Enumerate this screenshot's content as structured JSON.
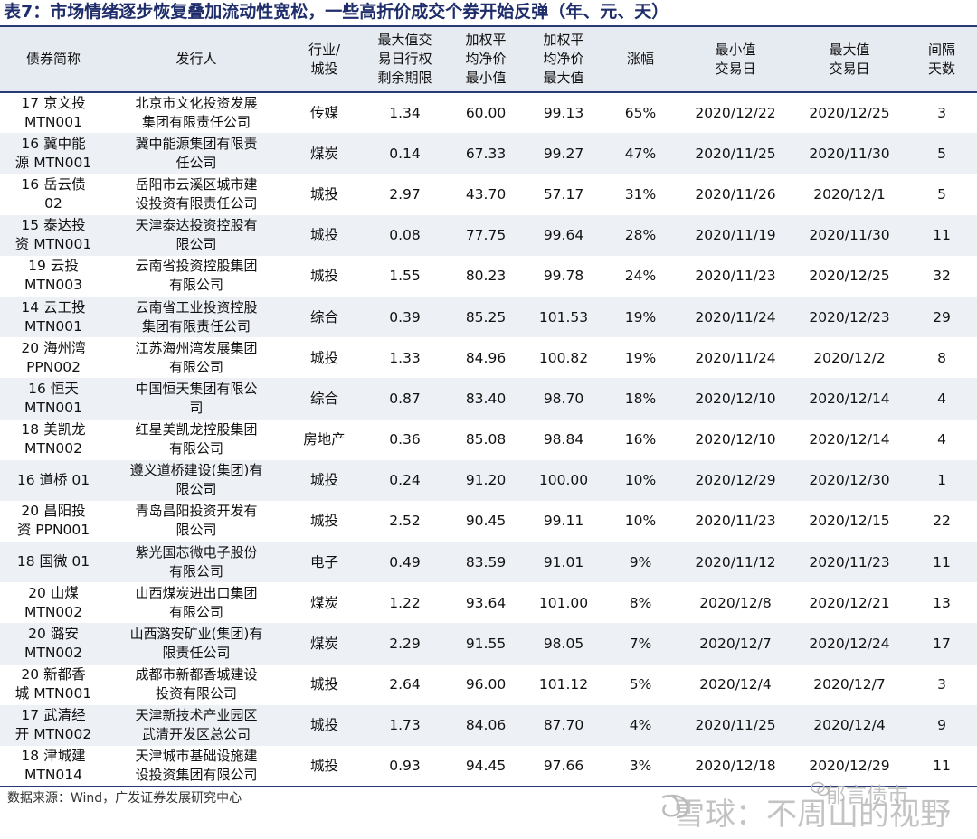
{
  "title": "表7：市场情绪逐步恢复叠加流动性宽松，一些高折价成交个券开始反弹（年、元、天）",
  "headers": {
    "name": "债券简称",
    "issuer": "发行人",
    "industry": "行业/\n城投",
    "remaining": "最大值交\n易日行权\n剩余期限",
    "min_price": "加权平\n均净价\n最小值",
    "max_price": "加权平\n均净价\n最大值",
    "rise": "涨幅",
    "min_date": "最小值\n交易日",
    "max_date": "最大值\n交易日",
    "interval": "间隔\n天数"
  },
  "rows": [
    {
      "name": "17 京文投\nMTN001",
      "issuer": "北京市文化投资发展\n集团有限责任公司",
      "industry": "传媒",
      "remaining": "1.34",
      "min_price": "60.00",
      "max_price": "99.13",
      "rise": "65%",
      "min_date": "2020/12/22",
      "max_date": "2020/12/25",
      "interval": "3"
    },
    {
      "name": "16 冀中能\n源 MTN001",
      "issuer": "冀中能源集团有限责\n任公司",
      "industry": "煤炭",
      "remaining": "0.14",
      "min_price": "67.33",
      "max_price": "99.27",
      "rise": "47%",
      "min_date": "2020/11/25",
      "max_date": "2020/11/30",
      "interval": "5"
    },
    {
      "name": "16 岳云债\n02",
      "issuer": "岳阳市云溪区城市建\n设投资有限责任公司",
      "industry": "城投",
      "remaining": "2.97",
      "min_price": "43.70",
      "max_price": "57.17",
      "rise": "31%",
      "min_date": "2020/11/26",
      "max_date": "2020/12/1",
      "interval": "5"
    },
    {
      "name": "15 泰达投\n资 MTN001",
      "issuer": "天津泰达投资控股有\n限公司",
      "industry": "城投",
      "remaining": "0.08",
      "min_price": "77.75",
      "max_price": "99.64",
      "rise": "28%",
      "min_date": "2020/11/19",
      "max_date": "2020/11/30",
      "interval": "11"
    },
    {
      "name": "19 云投\nMTN003",
      "issuer": "云南省投资控股集团\n有限公司",
      "industry": "城投",
      "remaining": "1.55",
      "min_price": "80.23",
      "max_price": "99.78",
      "rise": "24%",
      "min_date": "2020/11/23",
      "max_date": "2020/12/25",
      "interval": "32"
    },
    {
      "name": "14 云工投\nMTN001",
      "issuer": "云南省工业投资控股\n集团有限责任公司",
      "industry": "综合",
      "remaining": "0.39",
      "min_price": "85.25",
      "max_price": "101.53",
      "rise": "19%",
      "min_date": "2020/11/24",
      "max_date": "2020/12/23",
      "interval": "29"
    },
    {
      "name": "20 海州湾\nPPN002",
      "issuer": "江苏海州湾发展集团\n有限公司",
      "industry": "城投",
      "remaining": "1.33",
      "min_price": "84.96",
      "max_price": "100.82",
      "rise": "19%",
      "min_date": "2020/11/24",
      "max_date": "2020/12/2",
      "interval": "8"
    },
    {
      "name": "16 恒天\nMTN001",
      "issuer": "中国恒天集团有限公\n司",
      "industry": "综合",
      "remaining": "0.87",
      "min_price": "83.40",
      "max_price": "98.70",
      "rise": "18%",
      "min_date": "2020/12/10",
      "max_date": "2020/12/14",
      "interval": "4"
    },
    {
      "name": "18 美凯龙\nMTN002",
      "issuer": "红星美凯龙控股集团\n有限公司",
      "industry": "房地产",
      "remaining": "0.36",
      "min_price": "85.08",
      "max_price": "98.84",
      "rise": "16%",
      "min_date": "2020/12/10",
      "max_date": "2020/12/14",
      "interval": "4"
    },
    {
      "name": "16 道桥 01",
      "issuer": "遵义道桥建设(集团)有\n限公司",
      "industry": "城投",
      "remaining": "0.24",
      "min_price": "91.20",
      "max_price": "100.00",
      "rise": "10%",
      "min_date": "2020/12/29",
      "max_date": "2020/12/30",
      "interval": "1"
    },
    {
      "name": "20 昌阳投\n资 PPN001",
      "issuer": "青岛昌阳投资开发有\n限公司",
      "industry": "城投",
      "remaining": "2.52",
      "min_price": "90.45",
      "max_price": "99.11",
      "rise": "10%",
      "min_date": "2020/11/23",
      "max_date": "2020/12/15",
      "interval": "22"
    },
    {
      "name": "18 国微 01",
      "issuer": "紫光国芯微电子股份\n有限公司",
      "industry": "电子",
      "remaining": "0.49",
      "min_price": "83.59",
      "max_price": "91.01",
      "rise": "9%",
      "min_date": "2020/11/12",
      "max_date": "2020/11/23",
      "interval": "11"
    },
    {
      "name": "20 山煤\nMTN002",
      "issuer": "山西煤炭进出口集团\n有限公司",
      "industry": "煤炭",
      "remaining": "1.22",
      "min_price": "93.64",
      "max_price": "101.00",
      "rise": "8%",
      "min_date": "2020/12/8",
      "max_date": "2020/12/21",
      "interval": "13"
    },
    {
      "name": "20 潞安\nMTN002",
      "issuer": "山西潞安矿业(集团)有\n限责任公司",
      "industry": "煤炭",
      "remaining": "2.29",
      "min_price": "91.55",
      "max_price": "98.05",
      "rise": "7%",
      "min_date": "2020/12/7",
      "max_date": "2020/12/24",
      "interval": "17"
    },
    {
      "name": "20 新都香\n城 MTN001",
      "issuer": "成都市新都香城建设\n投资有限公司",
      "industry": "城投",
      "remaining": "2.64",
      "min_price": "96.00",
      "max_price": "101.12",
      "rise": "5%",
      "min_date": "2020/12/4",
      "max_date": "2020/12/7",
      "interval": "3"
    },
    {
      "name": "17 武清经\n开 MTN002",
      "issuer": "天津新技术产业园区\n武清开发区总公司",
      "industry": "城投",
      "remaining": "1.73",
      "min_price": "84.06",
      "max_price": "87.70",
      "rise": "4%",
      "min_date": "2020/11/25",
      "max_date": "2020/12/4",
      "interval": "9"
    },
    {
      "name": "18 津城建\nMTN014",
      "issuer": "天津城市基础设施建\n设投资集团有限公司",
      "industry": "城投",
      "remaining": "0.93",
      "min_price": "94.45",
      "max_price": "97.66",
      "rise": "3%",
      "min_date": "2020/12/18",
      "max_date": "2020/12/29",
      "interval": "11"
    }
  ],
  "source": "数据来源：Wind，广发证券发展研究中心",
  "watermark": {
    "line1": "郁言债市",
    "line2": "雪球：不周山的视野"
  }
}
